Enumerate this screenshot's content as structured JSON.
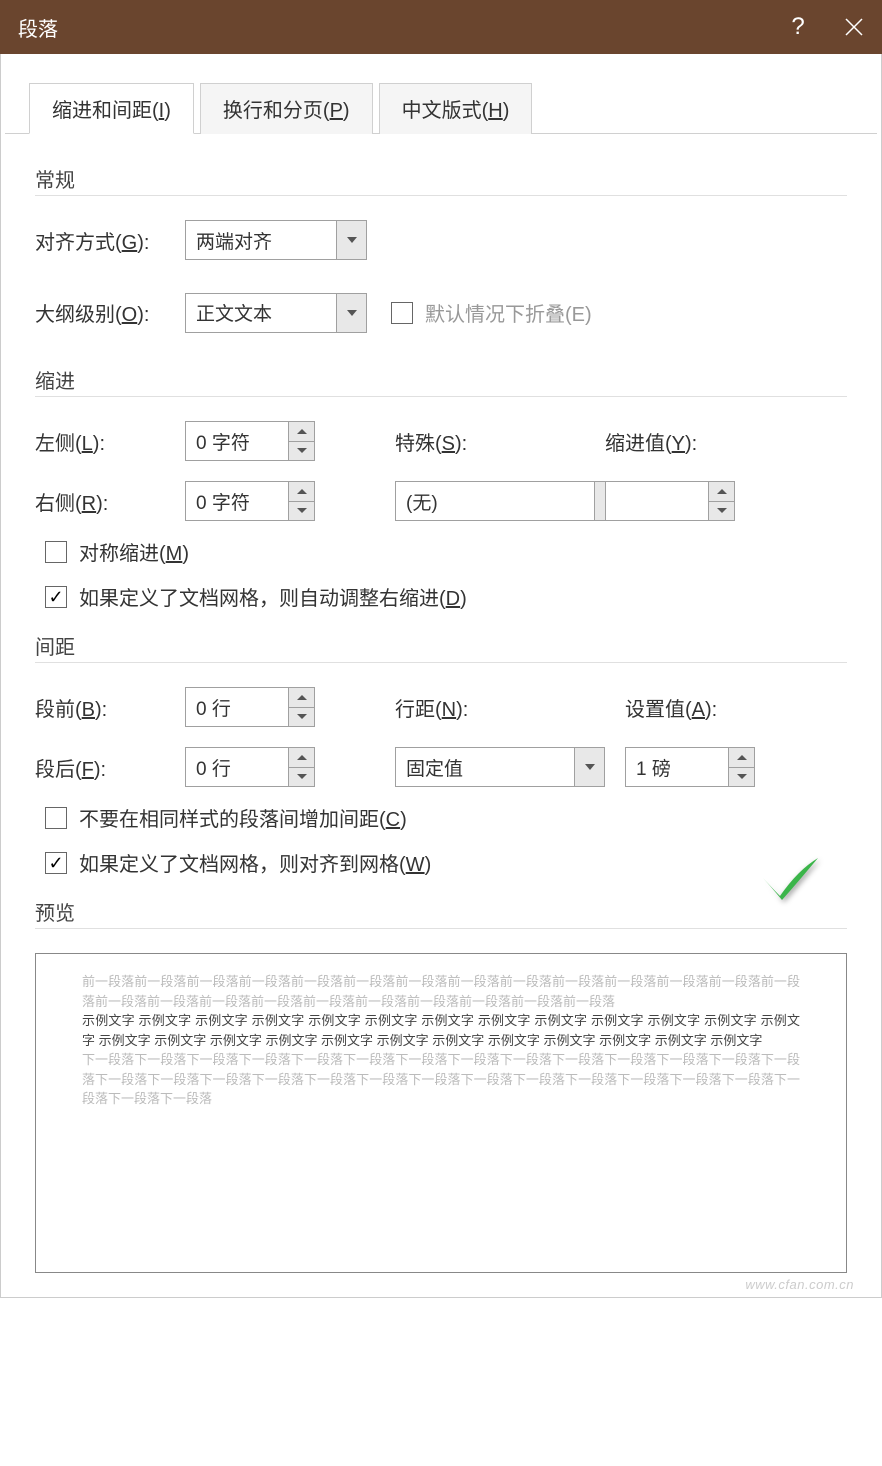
{
  "titlebar": {
    "title": "段落"
  },
  "tabs": {
    "indent": {
      "prefix": "缩进和间距(",
      "u": "I",
      "suffix": ")"
    },
    "pagebreak": {
      "prefix": "换行和分页(",
      "u": "P",
      "suffix": ")"
    },
    "chinese": {
      "prefix": "中文版式(",
      "u": "H",
      "suffix": ")"
    }
  },
  "groups": {
    "general": "常规",
    "indent": "缩进",
    "spacing": "间距",
    "preview": "预览"
  },
  "general": {
    "align_label_pre": "对齐方式(",
    "align_u": "G",
    "align_label_post": "):",
    "align_value": "两端对齐",
    "outline_label_pre": "大纲级别(",
    "outline_u": "O",
    "outline_label_post": "):",
    "outline_value": "正文文本",
    "collapsed_pre": "默认情况下折叠(",
    "collapsed_u": "E",
    "collapsed_post": ")"
  },
  "indent": {
    "left_pre": "左侧(",
    "left_u": "L",
    "left_post": "):",
    "left_value": "0 字符",
    "right_pre": "右侧(",
    "right_u": "R",
    "right_post": "):",
    "right_value": "0 字符",
    "special_pre": "特殊(",
    "special_u": "S",
    "special_post": "):",
    "special_value": "(无)",
    "indentval_pre": "缩进值(",
    "indentval_u": "Y",
    "indentval_post": "):",
    "indentval_value": "",
    "mirror_pre": "对称缩进(",
    "mirror_u": "M",
    "mirror_post": ")",
    "grid_pre": "如果定义了文档网格，则自动调整右缩进(",
    "grid_u": "D",
    "grid_post": ")"
  },
  "spacing": {
    "before_pre": "段前(",
    "before_u": "B",
    "before_post": "):",
    "before_value": "0 行",
    "after_pre": "段后(",
    "after_u": "F",
    "after_post": "):",
    "after_value": "0 行",
    "linespace_pre": "行距(",
    "linespace_u": "N",
    "linespace_post": "):",
    "linespace_value": "固定值",
    "at_pre": "设置值(",
    "at_u": "A",
    "at_post": "):",
    "at_value": "1 磅",
    "nosame_pre": "不要在相同样式的段落间增加间距(",
    "nosame_u": "C",
    "nosame_post": ")",
    "snap_pre": "如果定义了文档网格，则对齐到网格(",
    "snap_u": "W",
    "snap_post": ")"
  },
  "preview": {
    "prev": "前一段落前一段落前一段落前一段落前一段落前一段落前一段落前一段落前一段落前一段落前一段落前一段落前一段落前一段落前一段落前一段落前一段落前一段落前一段落前一段落前一段落前一段落前一段落前一段落",
    "sample": "示例文字 示例文字 示例文字 示例文字 示例文字 示例文字 示例文字 示例文字 示例文字 示例文字 示例文字 示例文字 示例文字 示例文字 示例文字 示例文字 示例文字 示例文字 示例文字 示例文字 示例文字 示例文字 示例文字 示例文字 示例文字",
    "next": "下一段落下一段落下一段落下一段落下一段落下一段落下一段落下一段落下一段落下一段落下一段落下一段落下一段落下一段落下一段落下一段落下一段落下一段落下一段落下一段落下一段落下一段落下一段落下一段落下一段落下一段落下一段落下一段落下一段落下一段落"
  },
  "watermark": "www.cfan.com.cn"
}
